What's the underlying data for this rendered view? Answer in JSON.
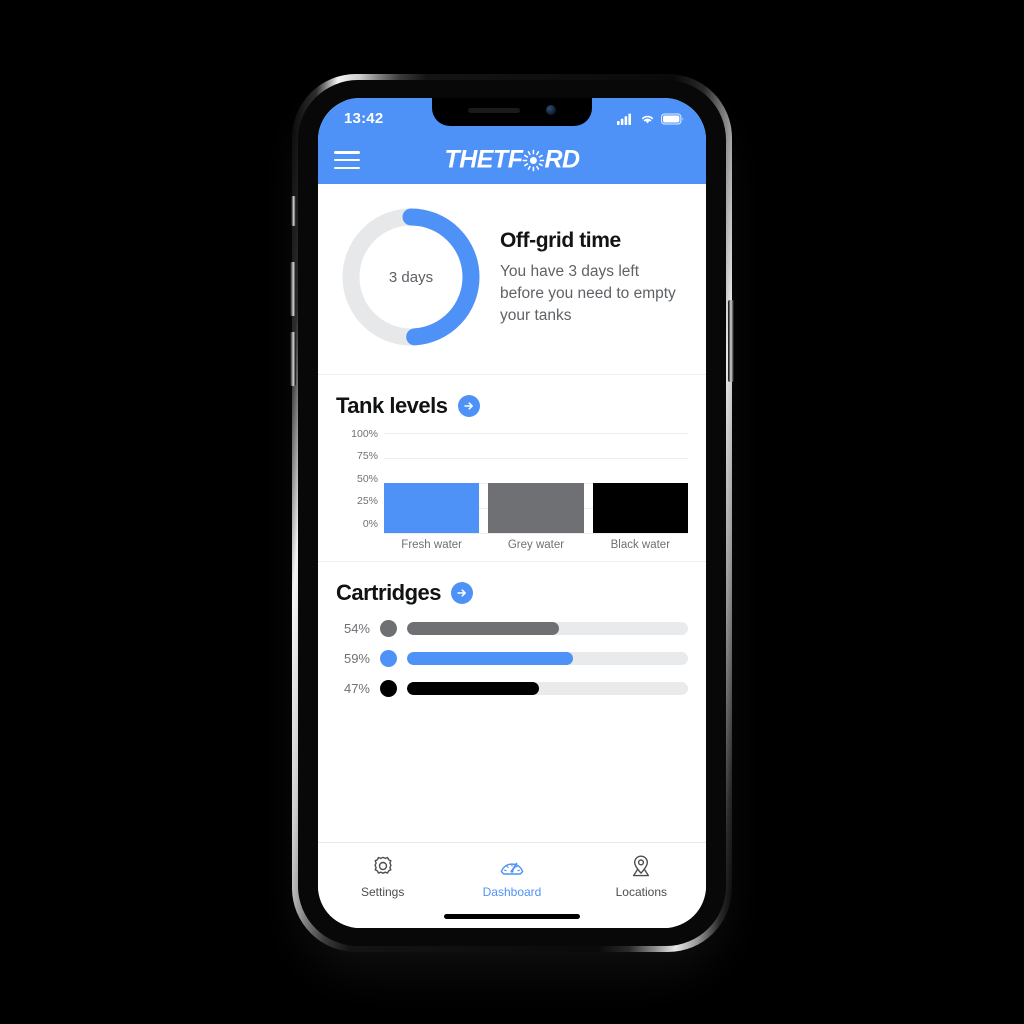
{
  "device": {
    "frame": "iphone-x"
  },
  "status_bar": {
    "time": "13:42",
    "icons": [
      "cellular-signal-icon",
      "wifi-icon",
      "battery-icon"
    ]
  },
  "app_bar": {
    "menu_icon": "hamburger-menu-icon",
    "brand_before": "THETF",
    "brand_burst_icon": "sunburst-o-icon",
    "brand_after": "RD",
    "brand_full": "THETFORD"
  },
  "offgrid": {
    "donut_label": "3 days",
    "donut_percent": 49,
    "title": "Off-grid time",
    "description": "You have 3 days left before you need to empty your tanks"
  },
  "tank_levels": {
    "title": "Tank levels",
    "arrow_icon": "arrow-right-icon"
  },
  "cartridges": {
    "title": "Cartridges",
    "arrow_icon": "arrow-right-icon",
    "items": [
      {
        "percent_label": "54%",
        "percent": 54,
        "color": "#6e7074"
      },
      {
        "percent_label": "59%",
        "percent": 59,
        "color": "#4f92f7"
      },
      {
        "percent_label": "47%",
        "percent": 47,
        "color": "#000000"
      }
    ]
  },
  "tab_bar": {
    "items": [
      {
        "label": "Settings",
        "icon": "gear-icon",
        "active": false
      },
      {
        "label": "Dashboard",
        "icon": "gauge-icon",
        "active": true
      },
      {
        "label": "Locations",
        "icon": "map-pin-icon",
        "active": false
      }
    ]
  },
  "colors": {
    "brand_blue": "#4f92f7",
    "grey": "#6e7074",
    "black": "#000000",
    "track": "#e9eaeb",
    "gridline": "#ededed"
  },
  "chart_data": {
    "type": "bar",
    "title": "Tank levels",
    "categories": [
      "Fresh water",
      "Grey water",
      "Black water"
    ],
    "values": [
      50,
      50,
      50
    ],
    "colors": [
      "#4f92f7",
      "#6e7074",
      "#000000"
    ],
    "xlabel": "",
    "ylabel": "",
    "ylim": [
      0,
      100
    ],
    "yticks": [
      100,
      75,
      50,
      25,
      0
    ],
    "ytick_labels": [
      "100%",
      "75%",
      "50%",
      "25%",
      "0%"
    ],
    "grid": true,
    "legend": false
  }
}
